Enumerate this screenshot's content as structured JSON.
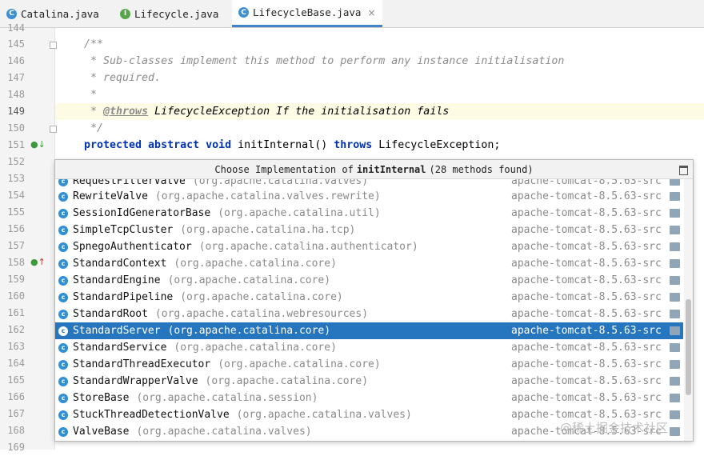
{
  "tabs": [
    {
      "label": "Catalina.java",
      "icon": "class-icon",
      "icon_letter": "C",
      "icon_color": "#3d8fd1",
      "active": false
    },
    {
      "label": "Lifecycle.java",
      "icon": "interface-icon",
      "icon_letter": "I",
      "icon_color": "#57a64a",
      "active": false
    },
    {
      "label": "LifecycleBase.java",
      "icon": "class-icon",
      "icon_letter": "C",
      "icon_color": "#3d8fd1",
      "active": true
    }
  ],
  "tab_close_glyph": "×",
  "editor": {
    "line_numbers": [
      "144",
      "145",
      "146",
      "147",
      "148",
      "149",
      "150",
      "151",
      "152",
      "153",
      "154",
      "155",
      "156",
      "157",
      "158",
      "159",
      "160",
      "161",
      "162",
      "163",
      "164",
      "165",
      "166",
      "167",
      "168",
      "169"
    ],
    "current_line": "149",
    "code": {
      "l145": "/**",
      "l146": " * Sub-classes implement this method to perform any instance initialisation",
      "l147": " * required.",
      "l148": " *",
      "l149_prefix": " * ",
      "l149_tag": "@throws",
      "l149_rest": " LifecycleException If the initialisation fails",
      "l150": " */",
      "l151_kw1": "protected abstract void",
      "l151_mid": " initInternal() ",
      "l151_kw2": "throws",
      "l151_end": " LifecycleException;"
    },
    "gutter_icons": [
      "implemented-method-icon",
      "overriding-method-icon"
    ]
  },
  "popup": {
    "title_prefix": "Choose Implementation of",
    "title_method": "initInternal",
    "title_suffix": "(28 methods found)",
    "partial_row": {
      "name": "RequestFilterValve",
      "package": "(org.apache.catalina.valves)",
      "module": "apache-tomcat-8.5.63-src"
    },
    "items": [
      {
        "name": "RewriteValve",
        "package": "(org.apache.catalina.valves.rewrite)",
        "module": "apache-tomcat-8.5.63-src"
      },
      {
        "name": "SessionIdGeneratorBase",
        "package": "(org.apache.catalina.util)",
        "module": "apache-tomcat-8.5.63-src"
      },
      {
        "name": "SimpleTcpCluster",
        "package": "(org.apache.catalina.ha.tcp)",
        "module": "apache-tomcat-8.5.63-src"
      },
      {
        "name": "SpnegoAuthenticator",
        "package": "(org.apache.catalina.authenticator)",
        "module": "apache-tomcat-8.5.63-src"
      },
      {
        "name": "StandardContext",
        "package": "(org.apache.catalina.core)",
        "module": "apache-tomcat-8.5.63-src"
      },
      {
        "name": "StandardEngine",
        "package": "(org.apache.catalina.core)",
        "module": "apache-tomcat-8.5.63-src"
      },
      {
        "name": "StandardPipeline",
        "package": "(org.apache.catalina.core)",
        "module": "apache-tomcat-8.5.63-src"
      },
      {
        "name": "StandardRoot",
        "package": "(org.apache.catalina.webresources)",
        "module": "apache-tomcat-8.5.63-src"
      },
      {
        "name": "StandardServer",
        "package": "(org.apache.catalina.core)",
        "module": "apache-tomcat-8.5.63-src"
      },
      {
        "name": "StandardService",
        "package": "(org.apache.catalina.core)",
        "module": "apache-tomcat-8.5.63-src"
      },
      {
        "name": "StandardThreadExecutor",
        "package": "(org.apache.catalina.core)",
        "module": "apache-tomcat-8.5.63-src"
      },
      {
        "name": "StandardWrapperValve",
        "package": "(org.apache.catalina.core)",
        "module": "apache-tomcat-8.5.63-src"
      },
      {
        "name": "StoreBase",
        "package": "(org.apache.catalina.session)",
        "module": "apache-tomcat-8.5.63-src"
      },
      {
        "name": "StuckThreadDetectionValve",
        "package": "(org.apache.catalina.valves)",
        "module": "apache-tomcat-8.5.63-src"
      },
      {
        "name": "ValveBase",
        "package": "(org.apache.catalina.valves)",
        "module": "apache-tomcat-8.5.63-src"
      }
    ],
    "selected_item": "StandardServer",
    "class_icon_letter": "c",
    "accent_color": "#2675bf"
  },
  "watermark": "@稀土掘金技术社区"
}
